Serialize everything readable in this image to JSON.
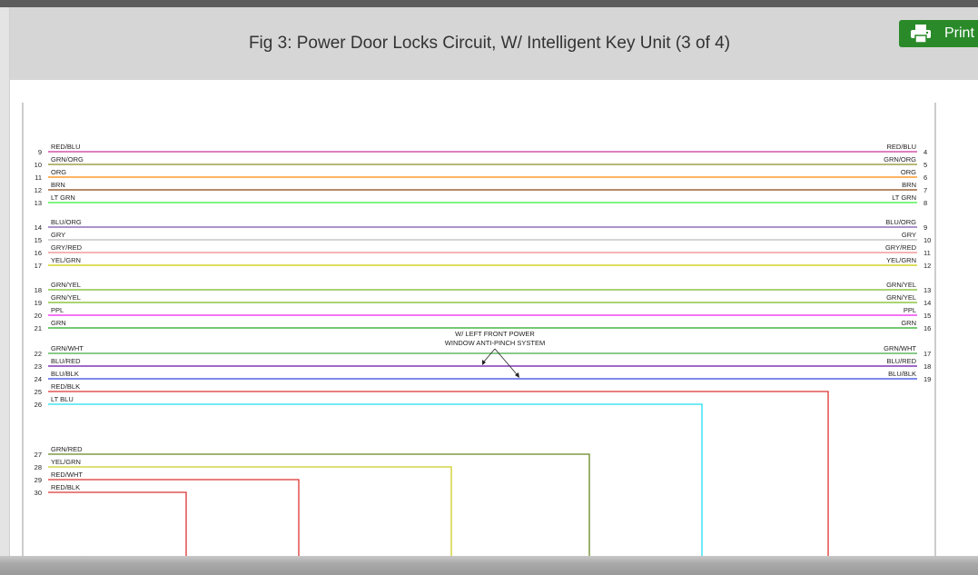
{
  "title": "Fig 3: Power Door Locks Circuit, W/ Intelligent Key Unit (3 of 4)",
  "print_button": {
    "label": "Print",
    "icon": "printer-icon",
    "color": "#2a8a2a"
  },
  "note": {
    "line1": "W/ LEFT FRONT POWER",
    "line2": "WINDOW ANTI-PINCH SYSTEM"
  },
  "through_wires": [
    {
      "left_pin": "9",
      "right_pin": "4",
      "left_label": "RED/BLU",
      "right_label": "RED/BLU",
      "color": "#cc3399"
    },
    {
      "left_pin": "10",
      "right_pin": "5",
      "left_label": "GRN/ORG",
      "right_label": "GRN/ORG",
      "color": "#8c8c2a"
    },
    {
      "left_pin": "11",
      "right_pin": "6",
      "left_label": "ORG",
      "right_label": "ORG",
      "color": "#ff8800"
    },
    {
      "left_pin": "12",
      "right_pin": "7",
      "left_label": "BRN",
      "right_label": "BRN",
      "color": "#8b4513"
    },
    {
      "left_pin": "13",
      "right_pin": "8",
      "left_label": "LT GRN",
      "right_label": "LT GRN",
      "color": "#33ee33"
    },
    {
      "left_pin": "14",
      "right_pin": "9",
      "left_label": "BLU/ORG",
      "right_label": "BLU/ORG",
      "color": "#7755aa"
    },
    {
      "left_pin": "15",
      "right_pin": "10",
      "left_label": "GRY",
      "right_label": "GRY",
      "color": "#bbbbbb"
    },
    {
      "left_pin": "16",
      "right_pin": "11",
      "left_label": "GRY/RED",
      "right_label": "GRY/RED",
      "color": "#ee8888"
    },
    {
      "left_pin": "17",
      "right_pin": "12",
      "left_label": "YEL/GRN",
      "right_label": "YEL/GRN",
      "color": "#cccc00"
    },
    {
      "left_pin": "18",
      "right_pin": "13",
      "left_label": "GRN/YEL",
      "right_label": "GRN/YEL",
      "color": "#77bb22"
    },
    {
      "left_pin": "19",
      "right_pin": "14",
      "left_label": "GRN/YEL",
      "right_label": "GRN/YEL",
      "color": "#77bb22"
    },
    {
      "left_pin": "20",
      "right_pin": "15",
      "left_label": "PPL",
      "right_label": "PPL",
      "color": "#ee22ee"
    },
    {
      "left_pin": "21",
      "right_pin": "16",
      "left_label": "GRN",
      "right_label": "GRN",
      "color": "#22aa22"
    },
    {
      "left_pin": "22",
      "right_pin": "17",
      "left_label": "GRN/WHT",
      "right_label": "GRN/WHT",
      "color": "#44aa44"
    },
    {
      "left_pin": "23",
      "right_pin": "18",
      "left_label": "BLU/RED",
      "right_label": "BLU/RED",
      "color": "#6611aa"
    },
    {
      "left_pin": "24",
      "right_pin": "19",
      "left_label": "BLU/BLK",
      "right_label": "BLU/BLK",
      "color": "#3344dd"
    }
  ],
  "drop_wires": [
    {
      "left_pin": "25",
      "left_label": "RED/BLK",
      "color": "#dd3333"
    },
    {
      "left_pin": "26",
      "left_label": "LT BLU",
      "color": "#22ddee"
    },
    {
      "left_pin": "27",
      "left_label": "GRN/RED",
      "color": "#668822"
    },
    {
      "left_pin": "28",
      "left_label": "YEL/GRN",
      "color": "#cccc22"
    },
    {
      "left_pin": "29",
      "left_label": "RED/WHT",
      "color": "#dd3333"
    },
    {
      "left_pin": "30",
      "left_label": "RED/BLK",
      "color": "#dd3333"
    }
  ]
}
